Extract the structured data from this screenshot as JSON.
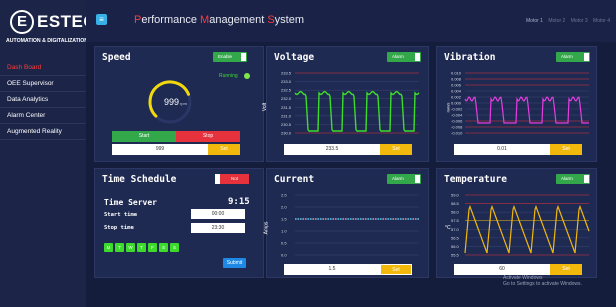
{
  "brand": {
    "logo_letter": "E",
    "name": "ESTEC",
    "tagline": "AUTOMATION & DIGITALIZATION"
  },
  "nav": {
    "items": [
      {
        "label": "Dash Board",
        "active": true
      },
      {
        "label": "OEE Supervisor",
        "active": false
      },
      {
        "label": "Data Analytics",
        "active": false
      },
      {
        "label": "Alarm Center",
        "active": false
      },
      {
        "label": "Augmented Reality",
        "active": false
      }
    ]
  },
  "header": {
    "menu_glyph": "≡",
    "title": {
      "cap1": "P",
      "rest1": "erformance ",
      "cap2": "M",
      "rest2": "anagement ",
      "cap3": "S",
      "rest3": "ystem"
    },
    "motors": [
      "Motor 1",
      "Motor 2",
      "Motor 3",
      "Motor 4"
    ]
  },
  "speed": {
    "title": "Speed",
    "toggle": "Enable",
    "status": "Running",
    "value": "999",
    "unit": "rpm",
    "gauge_fraction": 0.75,
    "start": "Start",
    "stop": "Stop",
    "input": "999",
    "set": "Set"
  },
  "voltage": {
    "title": "Voltage",
    "toggle": "Alarm",
    "ylabel": "Volt",
    "ticks": [
      "233.5",
      "233.0",
      "232.5",
      "232.0",
      "231.5",
      "231.0",
      "230.5",
      "230.0"
    ],
    "input": "233.5",
    "set": "Set",
    "line_color": "#3ddc2c",
    "alarm_color": "#e6323c"
  },
  "vibration": {
    "title": "Vibration",
    "toggle": "Alarm",
    "ylabel": "mm/s",
    "ticks": [
      "0.010",
      "0.008",
      "0.006",
      "0.004",
      "0.002",
      "0.000",
      "-0.002",
      "-0.004",
      "-0.006",
      "-0.008",
      "-0.010"
    ],
    "input": "0.01",
    "set": "Set",
    "line_color": "#e53ee0"
  },
  "schedule": {
    "title": "Time Schedule",
    "toggle": "Not",
    "server_label": "Time Server",
    "server_time": "9:15",
    "start_label": "Start time",
    "start_value": "00:00",
    "stop_label": "Stop time",
    "stop_value": "23:30",
    "days": [
      "M",
      "T",
      "W",
      "T",
      "F",
      "S",
      "S"
    ],
    "submit": "Submit"
  },
  "current": {
    "title": "Current",
    "toggle": "Alarm",
    "ylabel": "Amps",
    "ticks": [
      "2.5",
      "2.0",
      "1.5",
      "1.0",
      "0.5",
      "0.0"
    ],
    "input": "1.5",
    "set": "Set",
    "line_color": "#5bc8ef"
  },
  "temperature": {
    "title": "Temperature",
    "toggle": "Alarm",
    "ylabel": "°C",
    "ticks": [
      "59.0",
      "58.5",
      "58.0",
      "57.5",
      "57.0",
      "56.5",
      "56.0",
      "55.5"
    ],
    "input": "60",
    "set": "Set",
    "line_color": "#f2b90c"
  },
  "watermark": {
    "line1": "Activate Windows",
    "line2": "Go to Settings to activate Windows."
  }
}
